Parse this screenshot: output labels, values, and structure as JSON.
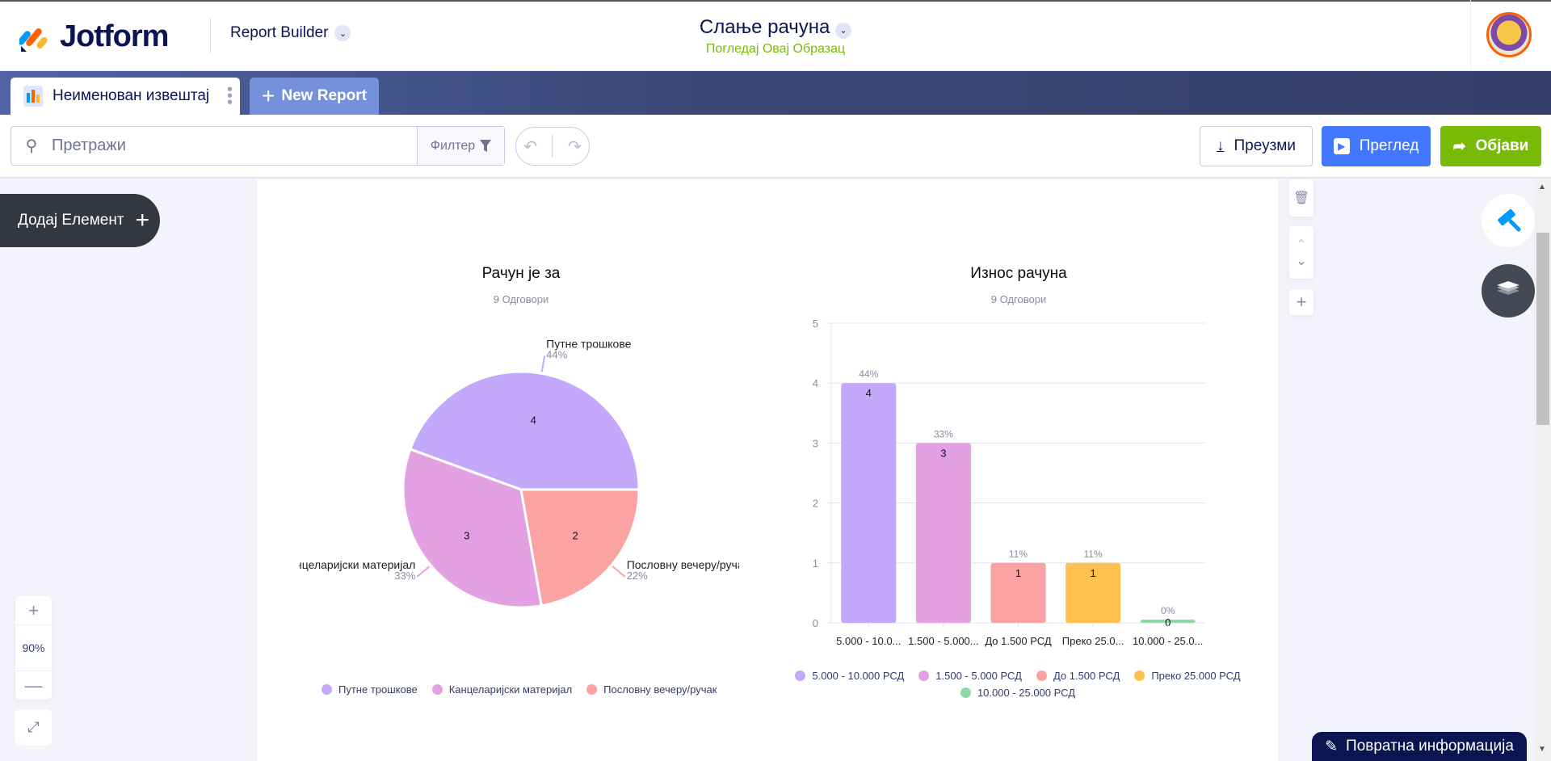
{
  "header": {
    "brand": "Jotform",
    "app_switcher": "Report Builder",
    "form_title": "Слање рачуна",
    "form_link": "Погледај Овај Образац"
  },
  "tabs": {
    "active": "Неименован извештај",
    "new_report": "New Report"
  },
  "toolbar": {
    "search_placeholder": "Претражи",
    "filter": "Филтер",
    "download": "Преузми",
    "preview": "Преглед",
    "publish": "Објави"
  },
  "left": {
    "add_element": "Додај Елемент",
    "zoom_level": "90%"
  },
  "feedback": "Повратна информација",
  "colors": {
    "purple": "#c4a8fc",
    "pink": "#e3a1e3",
    "salmon": "#fba3a3",
    "yellow": "#ffc250",
    "green": "#8fd8a8",
    "publish": "#78bb07",
    "preview": "#4277ff"
  },
  "chart_data": [
    {
      "type": "pie",
      "title": "Рачун је за",
      "subtitle": "9 Одговори",
      "categories": [
        "Путне трошкове",
        "Канцеларијски материјал",
        "Пословну вечеру/ручак"
      ],
      "values": [
        4,
        3,
        2
      ],
      "percent_labels": [
        "44%",
        "33%",
        "22%"
      ],
      "outside_labels": [
        "Путне трошкове",
        "Канцеларијски материјал",
        "Пословну вечеру/ручак"
      ],
      "legend": [
        "Путне трошкове",
        "Канцеларијски материјал",
        "Пословну вечеру/ручак"
      ],
      "legend_position": "bottom"
    },
    {
      "type": "bar",
      "title": "Износ рачуна",
      "subtitle": "9 Одговори",
      "categories": [
        "5.000 - 10.0...",
        "1.500 - 5.000...",
        "До 1.500 РСД",
        "Преко 25.0...",
        "10.000 - 25.0..."
      ],
      "values": [
        4,
        3,
        1,
        1,
        0
      ],
      "percent_labels": [
        "44%",
        "33%",
        "11%",
        "11%",
        "0%"
      ],
      "ylim": [
        0,
        5
      ],
      "yticks": [
        "0",
        "1",
        "2",
        "3",
        "4",
        "5"
      ],
      "grid": true,
      "legend": [
        "5.000 - 10.000 РСД",
        "1.500 - 5.000 РСД",
        "До 1.500 РСД",
        "Преко 25.000 РСД",
        "10.000 - 25.000 РСД"
      ],
      "legend_position": "bottom"
    }
  ]
}
